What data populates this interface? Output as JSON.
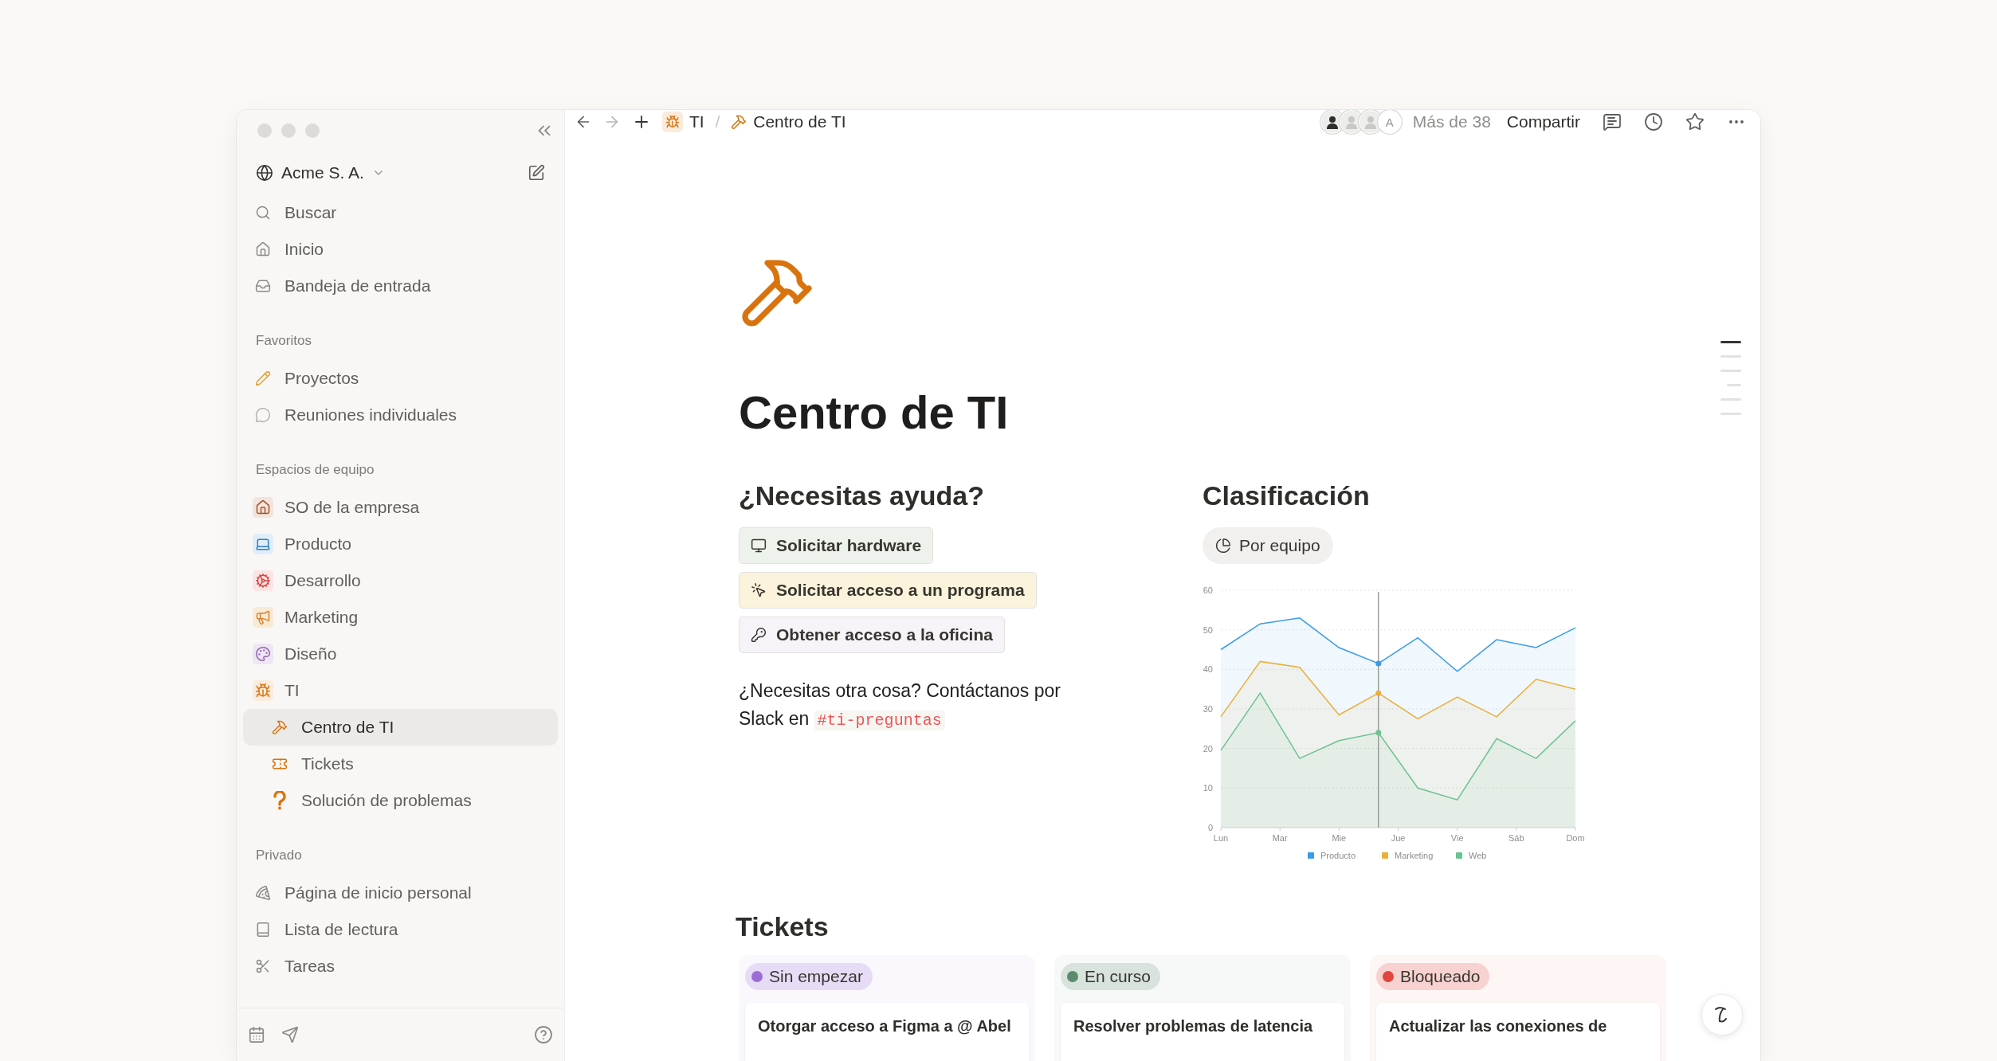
{
  "sidebar": {
    "workspace": "Acme S. A.",
    "nav": [
      {
        "label": "Buscar",
        "selected": false
      },
      {
        "label": "Inicio",
        "selected": false
      },
      {
        "label": "Bandeja de entrada",
        "selected": false
      }
    ],
    "sections": [
      {
        "title": "Favoritos",
        "items": [
          {
            "label": "Proyectos",
            "selected": false
          },
          {
            "label": "Reuniones individuales",
            "selected": false
          }
        ]
      },
      {
        "title": "Espacios de equipo",
        "items": [
          {
            "label": "SO de la empresa",
            "selected": false
          },
          {
            "label": "Producto",
            "selected": false
          },
          {
            "label": "Desarrollo",
            "selected": false
          },
          {
            "label": "Marketing",
            "selected": false
          },
          {
            "label": "Diseño",
            "selected": false
          },
          {
            "label": "TI",
            "selected": false,
            "children": [
              {
                "label": "Centro de TI",
                "selected": true
              },
              {
                "label": "Tickets",
                "selected": false
              },
              {
                "label": "Solución de problemas",
                "selected": false
              }
            ]
          }
        ]
      },
      {
        "title": "Privado",
        "items": [
          {
            "label": "Página de inicio personal",
            "selected": false
          },
          {
            "label": "Lista de lectura",
            "selected": false
          },
          {
            "label": "Tareas",
            "selected": false
          }
        ]
      }
    ]
  },
  "topbar": {
    "breadcrumb": [
      "TI",
      "Centro de TI"
    ],
    "separator": "/",
    "avatars": [
      {
        "kind": "figure"
      },
      {
        "kind": "figure"
      },
      {
        "kind": "figure"
      },
      {
        "kind": "initial",
        "text": "A"
      }
    ],
    "viewers": "Más de 38",
    "share": "Compartir"
  },
  "page": {
    "title": "Centro de TI",
    "help": {
      "heading": "¿Necesitas ayuda?",
      "buttons": [
        {
          "label": "Solicitar hardware",
          "color": "#edf3ec"
        },
        {
          "label": "Solicitar acceso a un programa",
          "color": "#fbf3db"
        },
        {
          "label": "Obtener acceso a la oficina",
          "color": "#f6f3f9"
        }
      ],
      "note": "¿Necesitas otra cosa? Contáctanos por Slack en",
      "channel": "#ti-preguntas"
    },
    "classification": {
      "heading": "Clasificación",
      "group_button": "Por equipo",
      "axis_labels": [
        "Mar",
        "Mie",
        "Jue",
        "Vie",
        "Sáb"
      ],
      "chart_data": {
        "type": "area",
        "stacked": false,
        "grid": true,
        "legend": "bottom",
        "categories": [
          "Lun",
          null,
          null,
          null,
          null,
          null,
          null,
          null,
          null,
          "Dom"
        ],
        "series": [
          {
            "name": "Producto",
            "type": "area",
            "color": "#3a9be8",
            "values": [
              45,
              51.5,
              53,
              45.5,
              41.5,
              48,
              39.5,
              47.5,
              45.5,
              50.5
            ]
          },
          {
            "name": "Marketing",
            "type": "area",
            "color": "#e8b03a",
            "values": [
              28,
              42,
              40.5,
              28.5,
              34,
              27.5,
              33,
              28,
              37.5,
              35
            ]
          },
          {
            "name": "Web",
            "type": "area",
            "color": "#6cc391",
            "values": [
              19.5,
              34,
              17.5,
              22,
              24,
              10,
              7,
              22.5,
              17.5,
              27
            ]
          }
        ],
        "ylim": [
          0,
          60
        ],
        "yticks": [
          0,
          10,
          20,
          30,
          40,
          50,
          60
        ]
      }
    },
    "tickets": {
      "heading": "Tickets",
      "columns": [
        {
          "status": "Sin empezar",
          "color": "#9a6dd7",
          "cards": [
            "Otorgar acceso a Figma a @ Abel"
          ]
        },
        {
          "status": "En curso",
          "color": "#5c8a6c",
          "cards": [
            "Resolver problemas de latencia"
          ]
        },
        {
          "status": "Bloqueado",
          "color": "#e0463e",
          "cards": [
            "Actualizar las conexiones de"
          ]
        }
      ]
    }
  },
  "outline": [
    {
      "selected": true
    },
    {
      "selected": false
    },
    {
      "selected": false
    },
    {
      "selected": false
    },
    {
      "selected": false
    },
    {
      "selected": false
    }
  ]
}
